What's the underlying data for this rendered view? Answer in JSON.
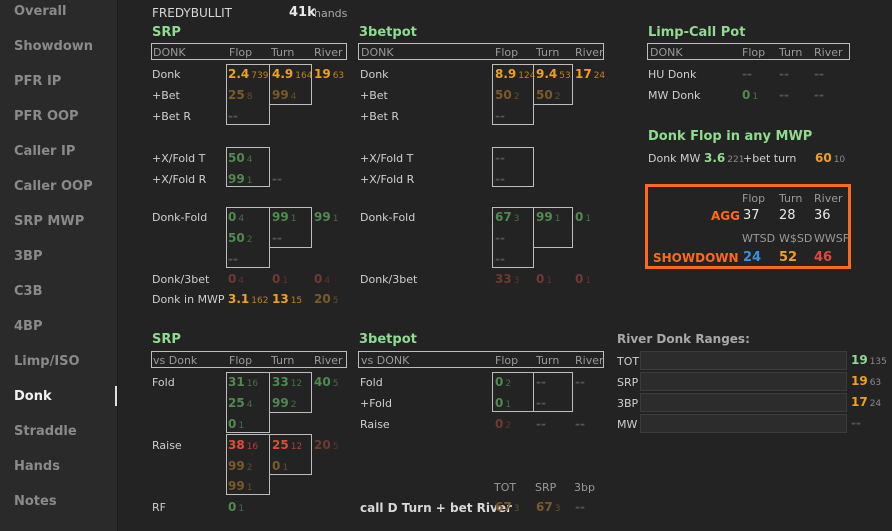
{
  "colors": {
    "accent_green": "#8fdc8f",
    "orange": "#f0a020",
    "red": "#e04a3a",
    "dimgreen": "#4f8a4f",
    "dimorange": "#7a5a28",
    "dimred": "#6e3a32",
    "blue": "#3a8fe0",
    "highlight": "#ff6a1a"
  },
  "sidebar": {
    "items": [
      "Overall",
      "Showdown",
      "PFR IP",
      "PFR OOP",
      "Caller IP",
      "Caller OOP",
      "SRP MWP",
      "3BP",
      "C3B",
      "4BP",
      "Limp/ISO",
      "Donk",
      "Straddle",
      "Hands",
      "Notes"
    ],
    "active": "Donk"
  },
  "player": {
    "name": "FREDYBULLIT",
    "hands": "41k",
    "hands_label": "hands"
  },
  "cols": {
    "flop": "Flop",
    "turn": "Turn",
    "river": "River"
  },
  "srp": {
    "title": "SRP",
    "header": "DONK",
    "rows": [
      "Donk",
      "+Bet",
      "+Bet R",
      "+X/Fold T",
      "+X/Fold R",
      "Donk-Fold",
      "Donk/3bet",
      "Donk in MWP"
    ]
  },
  "tbp": {
    "title": "3betpot",
    "header": "DONK",
    "rows": [
      "Donk",
      "+Bet",
      "+Bet R",
      "+X/Fold T",
      "+X/Fold R",
      "Donk-Fold",
      "Donk/3bet"
    ]
  },
  "limp": {
    "title": "Limp-Call Pot",
    "header": "DONK",
    "rows": [
      "HU Donk",
      "MW Donk"
    ]
  },
  "mwp": {
    "title": "Donk Flop in any MWP",
    "label": "Donk MW",
    "v1": "3.6",
    "n1": "221",
    "label2": "+bet turn",
    "v2": "60",
    "n2": "10"
  },
  "agg": {
    "cols": [
      "Flop",
      "Turn",
      "River"
    ],
    "label": "AGG",
    "values": [
      "37",
      "28",
      "36"
    ],
    "sd_cols": [
      "WTSD",
      "W$SD",
      "WWSF"
    ],
    "sd_label": "SHOWDOWN",
    "sd_values": [
      "24",
      "52",
      "46"
    ]
  },
  "vs_srp": {
    "title": "SRP",
    "header": "vs Donk",
    "rows": [
      "Fold",
      "Raise",
      "RF"
    ]
  },
  "vs_tbp": {
    "title": "3betpot",
    "header": "vs DONK",
    "rows": [
      "Fold",
      "+Fold",
      "Raise"
    ],
    "call_label": "call D Turn + bet River",
    "tot": "TOT",
    "srp": "SRP",
    "tbp": "3bp"
  },
  "ranges": {
    "title": "River Donk Ranges:",
    "rows": [
      {
        "label": "TOT",
        "v": "19",
        "n": "135"
      },
      {
        "label": "SRP",
        "v": "19",
        "n": "63"
      },
      {
        "label": "3BP",
        "v": "17",
        "n": "24"
      },
      {
        "label": "MW",
        "v": "--",
        "n": ""
      }
    ]
  },
  "values": [
    {
      "v": "2.4",
      "n": "739",
      "c": "#f0a020"
    },
    {
      "v": "4.9",
      "n": "164",
      "c": "#f0a020"
    },
    {
      "v": "19",
      "n": "63",
      "c": "#f0a020"
    },
    {
      "v": "25",
      "n": "8",
      "c": "#7a5a28"
    },
    {
      "v": "99",
      "n": "4",
      "c": "#7a5a28"
    },
    {
      "v": "--",
      "n": "",
      "c": "#555555"
    },
    {
      "v": "50",
      "n": "4",
      "c": "#4f8a4f"
    },
    {
      "v": "99",
      "n": "1",
      "c": "#4f8a4f"
    },
    {
      "v": "--",
      "n": "",
      "c": "#555555"
    },
    {
      "v": "0",
      "n": "4",
      "c": "#4f8a4f"
    },
    {
      "v": "99",
      "n": "1",
      "c": "#4f8a4f"
    },
    {
      "v": "99",
      "n": "1",
      "c": "#4f8a4f"
    },
    {
      "v": "50",
      "n": "2",
      "c": "#4f8a4f"
    },
    {
      "v": "--",
      "n": "",
      "c": "#555555"
    },
    {
      "v": "--",
      "n": "",
      "c": "#555555"
    },
    {
      "v": "0",
      "n": "4",
      "c": "#6e3a32"
    },
    {
      "v": "0",
      "n": "1",
      "c": "#6e3a32"
    },
    {
      "v": "0",
      "n": "4",
      "c": "#6e3a32"
    },
    {
      "v": "3.1",
      "n": "162",
      "c": "#f0a020"
    },
    {
      "v": "13",
      "n": "15",
      "c": "#f0a020"
    },
    {
      "v": "20",
      "n": "5",
      "c": "#7a5a28"
    },
    {
      "v": "8.9",
      "n": "124",
      "c": "#f0a020"
    },
    {
      "v": "9.4",
      "n": "53",
      "c": "#f0a020"
    },
    {
      "v": "17",
      "n": "24",
      "c": "#f0a020"
    },
    {
      "v": "50",
      "n": "2",
      "c": "#7a5a28"
    },
    {
      "v": "50",
      "n": "2",
      "c": "#7a5a28"
    },
    {
      "v": "--",
      "n": "",
      "c": "#555555"
    },
    {
      "v": "--",
      "n": "",
      "c": "#555555"
    },
    {
      "v": "--",
      "n": "",
      "c": "#555555"
    },
    {
      "v": "67",
      "n": "3",
      "c": "#4f8a4f"
    },
    {
      "v": "99",
      "n": "1",
      "c": "#4f8a4f"
    },
    {
      "v": "0",
      "n": "1",
      "c": "#4f8a4f"
    },
    {
      "v": "--",
      "n": "",
      "c": "#555555"
    },
    {
      "v": "--",
      "n": "",
      "c": "#555555"
    },
    {
      "v": "33",
      "n": "3",
      "c": "#6e3a32"
    },
    {
      "v": "0",
      "n": "1",
      "c": "#6e3a32"
    },
    {
      "v": "0",
      "n": "1",
      "c": "#6e3a32"
    },
    {
      "v": "--",
      "n": "",
      "c": "#555555"
    },
    {
      "v": "--",
      "n": "",
      "c": "#555555"
    },
    {
      "v": "--",
      "n": "",
      "c": "#555555"
    },
    {
      "v": "0",
      "n": "1",
      "c": "#4f8a4f"
    },
    {
      "v": "--",
      "n": "",
      "c": "#555555"
    },
    {
      "v": "--",
      "n": "",
      "c": "#555555"
    },
    {
      "v": "31",
      "n": "16",
      "c": "#4f8a4f"
    },
    {
      "v": "33",
      "n": "12",
      "c": "#4f8a4f"
    },
    {
      "v": "40",
      "n": "5",
      "c": "#4f8a4f"
    },
    {
      "v": "25",
      "n": "4",
      "c": "#4f8a4f"
    },
    {
      "v": "99",
      "n": "2",
      "c": "#4f8a4f"
    },
    {
      "v": "0",
      "n": "1",
      "c": "#4f8a4f"
    },
    {
      "v": "38",
      "n": "16",
      "c": "#e04a3a"
    },
    {
      "v": "25",
      "n": "12",
      "c": "#e04a3a"
    },
    {
      "v": "20",
      "n": "5",
      "c": "#6e3a32"
    },
    {
      "v": "99",
      "n": "2",
      "c": "#7a5a28"
    },
    {
      "v": "0",
      "n": "1",
      "c": "#7a5a28"
    },
    {
      "v": "99",
      "n": "1",
      "c": "#7a5a28"
    },
    {
      "v": "0",
      "n": "1",
      "c": "#4f8a4f"
    },
    {
      "v": "0",
      "n": "2",
      "c": "#4f8a4f"
    },
    {
      "v": "--",
      "n": "",
      "c": "#555555"
    },
    {
      "v": "--",
      "n": "",
      "c": "#555555"
    },
    {
      "v": "0",
      "n": "1",
      "c": "#4f8a4f"
    },
    {
      "v": "--",
      "n": "",
      "c": "#555555"
    },
    {
      "v": "0",
      "n": "2",
      "c": "#6e3a32"
    },
    {
      "v": "--",
      "n": "",
      "c": "#555555"
    },
    {
      "v": "--",
      "n": "",
      "c": "#555555"
    },
    {
      "v": "67",
      "n": "3",
      "c": "#7a5a28"
    },
    {
      "v": "67",
      "n": "3",
      "c": "#7a5a28"
    },
    {
      "v": "--",
      "n": "",
      "c": "#555555"
    }
  ]
}
